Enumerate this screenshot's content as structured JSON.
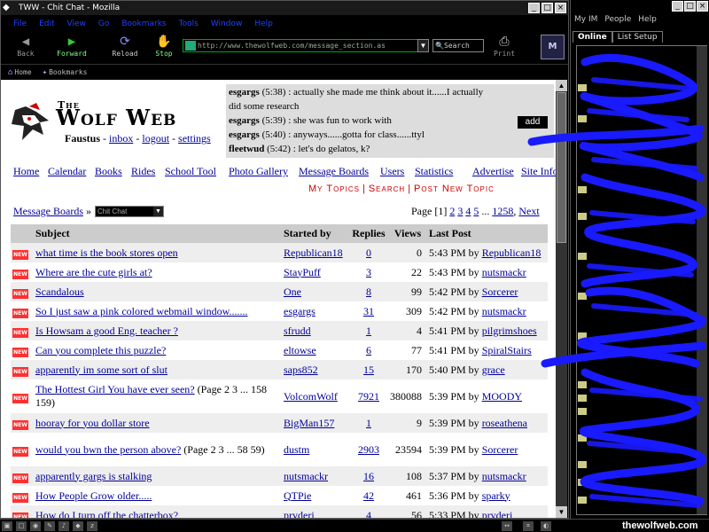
{
  "window": {
    "title": "TWW - Chit Chat - Mozilla"
  },
  "menu": [
    "File",
    "Edit",
    "View",
    "Go",
    "Bookmarks",
    "Tools",
    "Window",
    "Help"
  ],
  "nav": {
    "back": "Back",
    "forward": "Forward",
    "reload": "Reload",
    "stop": "Stop",
    "url": "http://www.thewolfweb.com/message_section.as",
    "search": "Search",
    "print": "Print"
  },
  "bookmarks": {
    "home": "Home",
    "bookmarks": "Bookmarks"
  },
  "site": {
    "title_the": "The",
    "title_main": "Wolf Web",
    "username": "Faustus",
    "links": {
      "inbox": "inbox",
      "logout": "logout",
      "settings": "settings"
    },
    "sep": " - "
  },
  "chatterbox": {
    "lines": [
      {
        "user": "esgargs",
        "time": "(5:38)",
        "text": ": actually she made me think about it......I actually"
      },
      {
        "user": "",
        "time": "",
        "text": "did some research"
      },
      {
        "user": "esgargs",
        "time": "(5:39)",
        "text": ": she was fun to work with"
      },
      {
        "user": "esgargs",
        "time": "(5:40)",
        "text": ": anyways......gotta for class......ttyl"
      },
      {
        "user": "fleetwud",
        "time": "(5:42)",
        "text": ": let's do gelatos, k?"
      }
    ],
    "add_label": "add"
  },
  "site_nav": [
    "Home",
    "Calendar",
    "Books",
    "Rides",
    "School Tool",
    "Photo Gallery",
    "Message Boards",
    "Users",
    "Statistics",
    "Advertise",
    "Site Info"
  ],
  "topic_links": [
    "My Topics",
    "Search",
    "Post New Topic"
  ],
  "breadcrumb": {
    "root": "Message Boards",
    "sep": "»",
    "board": "Chit Chat"
  },
  "pager": {
    "label": "Page",
    "current": "[1]",
    "pages": [
      "2",
      "3",
      "4",
      "5"
    ],
    "ellipsis": "...",
    "last": "1258",
    "next": "Next"
  },
  "table": {
    "headers": {
      "subject": "Subject",
      "started_by": "Started by",
      "replies": "Replies",
      "views": "Views",
      "last_post": "Last Post"
    },
    "new_badge": "NEW",
    "rows": [
      {
        "subject": "what time is the book stores open",
        "pages": "",
        "starter": "Republican18",
        "replies": "0",
        "views": "0",
        "time": "5:43 PM by",
        "by": "Republican18"
      },
      {
        "subject": "Where are the cute girls at?",
        "pages": "",
        "starter": "StayPuff",
        "replies": "3",
        "views": "22",
        "time": "5:43 PM by",
        "by": "nutsmackr"
      },
      {
        "subject": "Scandalous",
        "pages": "",
        "starter": "One",
        "replies": "8",
        "views": "99",
        "time": "5:42 PM by",
        "by": "Sorcerer"
      },
      {
        "subject": "So I just saw a pink colored webmail window.......",
        "pages": "",
        "starter": "esgargs",
        "replies": "31",
        "views": "309",
        "time": "5:42 PM by",
        "by": "nutsmackr"
      },
      {
        "subject": "Is Howsam a good Eng. teacher ?",
        "pages": "",
        "starter": "sfrudd",
        "replies": "1",
        "views": "4",
        "time": "5:41 PM by",
        "by": "pilgrimshoes"
      },
      {
        "subject": "Can you complete this puzzle?",
        "pages": "",
        "starter": "eltowse",
        "replies": "6",
        "views": "77",
        "time": "5:41 PM by",
        "by": "SpiralStairs"
      },
      {
        "subject": "apparently im some sort of slut",
        "pages": "",
        "starter": "saps852",
        "replies": "15",
        "views": "170",
        "time": "5:40 PM by",
        "by": "grace"
      },
      {
        "subject": "The Hottest Girl You have ever seen?",
        "pages": "(Page 2 3 ... 158 159)",
        "starter": "VolcomWolf",
        "replies": "7921",
        "views": "380088",
        "time": "5:39 PM by",
        "by": "MOODY"
      },
      {
        "subject": "hooray for you dollar store",
        "pages": "",
        "starter": "BigMan157",
        "replies": "1",
        "views": "9",
        "time": "5:39 PM by",
        "by": "roseathena"
      },
      {
        "subject": "would you bwn the person above?",
        "pages": "(Page 2 3 ... 58 59)",
        "starter": "dustm",
        "replies": "2903",
        "views": "23594",
        "time": "5:39 PM by",
        "by": "Sorcerer"
      },
      {
        "subject": "apparently gargs is stalking",
        "pages": "",
        "starter": "nutsmackr",
        "replies": "16",
        "views": "108",
        "time": "5:37 PM by",
        "by": "nutsmackr"
      },
      {
        "subject": "How People Grow older.....",
        "pages": "",
        "starter": "QTPie",
        "replies": "42",
        "views": "461",
        "time": "5:36 PM by",
        "by": "sparky"
      },
      {
        "subject": "How do I turn off the chatterbox?",
        "pages": "",
        "starter": "prvderi",
        "replies": "4",
        "views": "56",
        "time": "5:33 PM by",
        "by": "prvderi"
      }
    ]
  },
  "aim": {
    "menu": [
      "My IM",
      "People",
      "Help"
    ],
    "tabs": [
      "Online",
      "List Setup"
    ]
  },
  "watermark": "thewolfweb.com",
  "colors": {
    "link": "#000099",
    "topic_red": "#cc0000",
    "scribble": "#1a1aff",
    "header_gray": "#cccccc"
  }
}
